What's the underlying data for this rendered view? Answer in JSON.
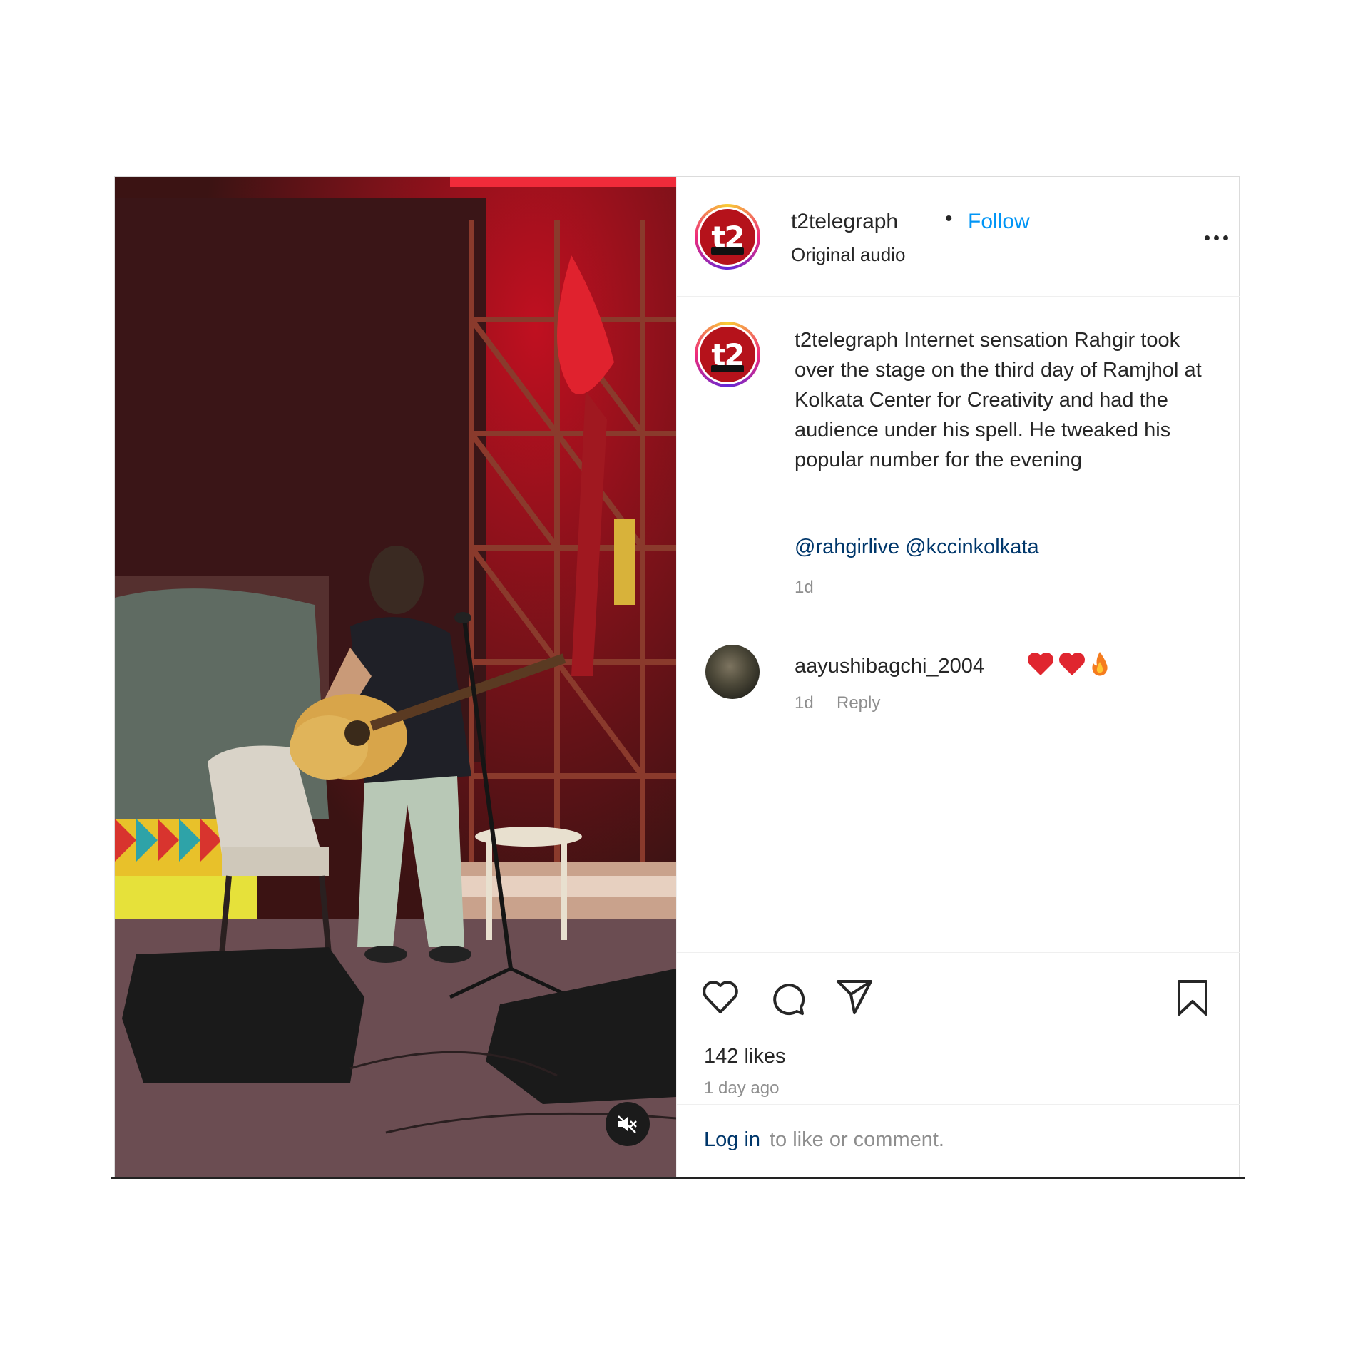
{
  "header": {
    "username": "t2telegraph",
    "separator": "•",
    "follow_label": "Follow",
    "audio_label": "Original audio",
    "avatar_logo_text": "t2"
  },
  "caption": {
    "username": "t2telegraph",
    "text": "Internet sensation Rahgir took over the stage on the third day of Ramjhol at Kolkata Center for Creativity and had the audience under his spell. He tweaked his popular number for the evening",
    "mentions": [
      "@rahgirlive",
      "@kccinkolkata"
    ],
    "time": "1d"
  },
  "comment": {
    "username": "aayushibagchi_2004",
    "emojis": [
      "red-heart",
      "red-heart",
      "fire"
    ],
    "time": "1d",
    "reply_label": "Reply"
  },
  "actions": {
    "icons": [
      "heart-icon",
      "comment-icon",
      "share-icon",
      "bookmark-icon"
    ],
    "likes": "142 likes",
    "age": "1 day ago"
  },
  "login": {
    "link": "Log in",
    "rest": "to like or comment."
  },
  "colors": {
    "follow_blue": "#0095f6",
    "mention_blue": "#00376b",
    "secondary_text": "#8e8e8e"
  }
}
